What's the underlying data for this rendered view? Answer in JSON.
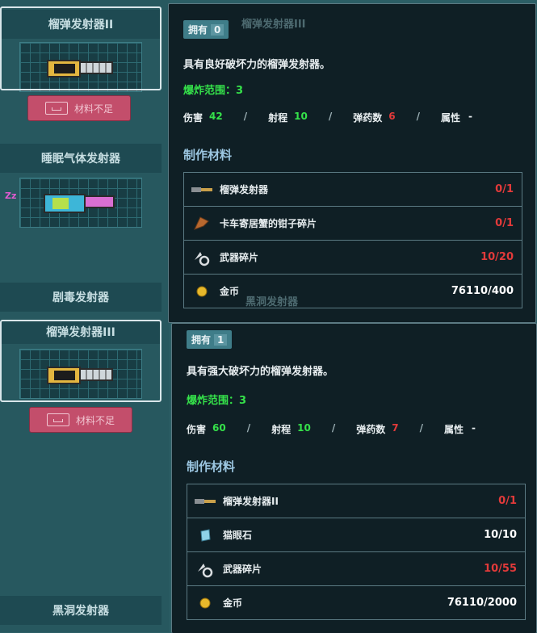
{
  "left_list": {
    "cards": [
      {
        "title": "榴弹发射器II"
      },
      {
        "title": "睡眠气体发射器"
      },
      {
        "title": "剧毒发射器"
      },
      {
        "title": "榴弹发射器III"
      },
      {
        "title": "黑洞发射器"
      }
    ],
    "insufficient_label": "材料不足",
    "sleep_badge": "Zz"
  },
  "ghost": {
    "top_title": "榴弹发射器III",
    "mid_title": "黑洞发射器"
  },
  "panel_top": {
    "owned_label": "拥有",
    "owned_count": "0",
    "description": "具有良好破坏力的榴弹发射器。",
    "blast_range": "爆炸范围：3",
    "stats": {
      "damage_label": "伤害",
      "damage": "42",
      "range_label": "射程",
      "range": "10",
      "ammo_label": "弹药数",
      "ammo": "6",
      "attr_label": "属性",
      "attr": "-",
      "sep": "/"
    },
    "materials_title": "制作材料",
    "materials": [
      {
        "name": "榴弹发射器",
        "qty": "0/1",
        "icon": "grenade-launcher-icon"
      },
      {
        "name": "卡车寄居蟹的钳子碎片",
        "qty": "0/1",
        "icon": "crab-claw-icon"
      },
      {
        "name": "武器碎片",
        "qty": "10/20",
        "icon": "weapon-shard-icon"
      },
      {
        "name": "金币",
        "qty": "76110/400",
        "icon": "gold-coin-icon"
      }
    ]
  },
  "panel_bottom": {
    "owned_label": "拥有",
    "owned_count": "1",
    "description": "具有强大破坏力的榴弹发射器。",
    "blast_range": "爆炸范围：3",
    "stats": {
      "damage_label": "伤害",
      "damage": "60",
      "range_label": "射程",
      "range": "10",
      "ammo_label": "弹药数",
      "ammo": "7",
      "attr_label": "属性",
      "attr": "-",
      "sep": "/"
    },
    "materials_title": "制作材料",
    "materials": [
      {
        "name": "榴弹发射器II",
        "qty": "0/1",
        "icon": "grenade-launcher-icon"
      },
      {
        "name": "猫眼石",
        "qty": "10/10",
        "icon": "cats-eye-gem-icon"
      },
      {
        "name": "武器碎片",
        "qty": "10/55",
        "icon": "weapon-shard-icon"
      },
      {
        "name": "金币",
        "qty": "76110/2000",
        "icon": "gold-coin-icon"
      }
    ]
  }
}
